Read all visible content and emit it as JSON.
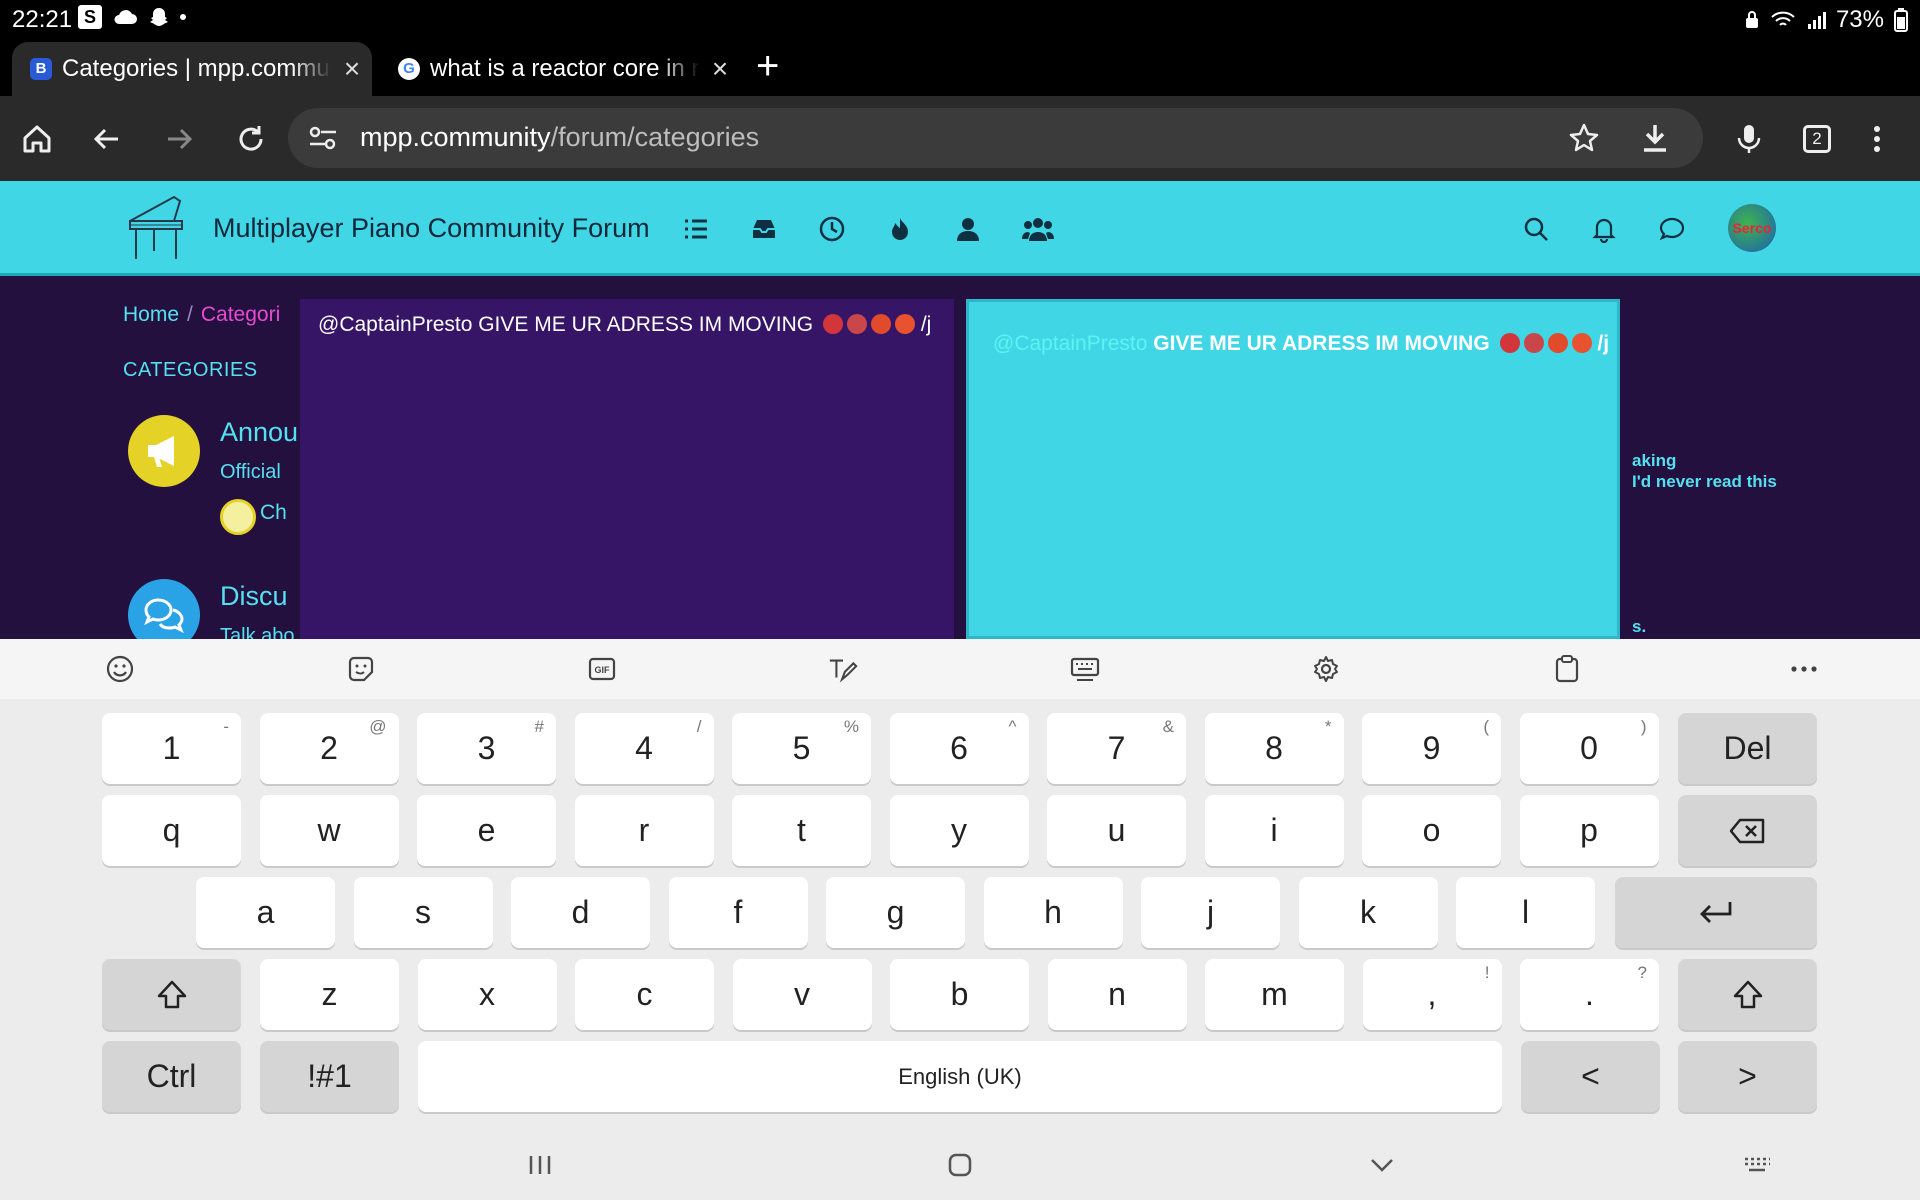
{
  "status_bar": {
    "time": "22:21",
    "battery": "73%"
  },
  "tabs": [
    {
      "favicon_letter": "B",
      "title": "Categories | mpp.community",
      "close": "×",
      "active": true
    },
    {
      "favicon_letter": "G",
      "title": "what is a reactor core in real life",
      "close": "×",
      "active": false
    }
  ],
  "new_tab_label": "+",
  "address_bar": {
    "domain": "mpp.community",
    "path": "/forum/categories",
    "tab_count": "2"
  },
  "forum": {
    "title": "Multiplayer Piano Community Forum",
    "avatar_text": "Serco",
    "breadcrumb": {
      "home": "Home",
      "sep": "/",
      "current": "Categori"
    },
    "categories_heading": "CATEGORIES",
    "categories": [
      {
        "title": "Annou",
        "desc": "Official",
        "child": "Ch",
        "color": "#e5d226"
      },
      {
        "title": "Discu",
        "desc": "Talk abo",
        "color": "#2aa3e6"
      }
    ],
    "composer_text": "@CaptainPresto GIVE ME UR ADRESS IM MOVING",
    "composer_suffix": "/j",
    "preview": {
      "mention": "@CaptainPresto",
      "text": " GIVE ME UR ADRESS IM MOVING",
      "suffix": "/j"
    },
    "side_texts": [
      "aking",
      "I'd never read this",
      "s."
    ]
  },
  "keyboard": {
    "rows": [
      [
        {
          "k": "1",
          "h": "-"
        },
        {
          "k": "2",
          "h": "@"
        },
        {
          "k": "3",
          "h": "#"
        },
        {
          "k": "4",
          "h": "/"
        },
        {
          "k": "5",
          "h": "%"
        },
        {
          "k": "6",
          "h": "^"
        },
        {
          "k": "7",
          "h": "&"
        },
        {
          "k": "8",
          "h": "*"
        },
        {
          "k": "9",
          "h": "("
        },
        {
          "k": "0",
          "h": ")"
        }
      ],
      [
        {
          "k": "q"
        },
        {
          "k": "w"
        },
        {
          "k": "e"
        },
        {
          "k": "r"
        },
        {
          "k": "t"
        },
        {
          "k": "y"
        },
        {
          "k": "u"
        },
        {
          "k": "i"
        },
        {
          "k": "o"
        },
        {
          "k": "p"
        }
      ],
      [
        {
          "k": "a"
        },
        {
          "k": "s"
        },
        {
          "k": "d"
        },
        {
          "k": "f"
        },
        {
          "k": "g"
        },
        {
          "k": "h"
        },
        {
          "k": "j"
        },
        {
          "k": "k"
        },
        {
          "k": "l"
        }
      ],
      [
        {
          "k": "z"
        },
        {
          "k": "x"
        },
        {
          "k": "c"
        },
        {
          "k": "v"
        },
        {
          "k": "b"
        },
        {
          "k": "n"
        },
        {
          "k": "m"
        },
        {
          "k": ",",
          "h": "!"
        },
        {
          "k": ".",
          "h": "?"
        }
      ]
    ],
    "del_label": "Del",
    "ctrl_label": "Ctrl",
    "symbols_label": "!#1",
    "space_label": "English (UK)",
    "left_label": "<",
    "right_label": ">"
  }
}
